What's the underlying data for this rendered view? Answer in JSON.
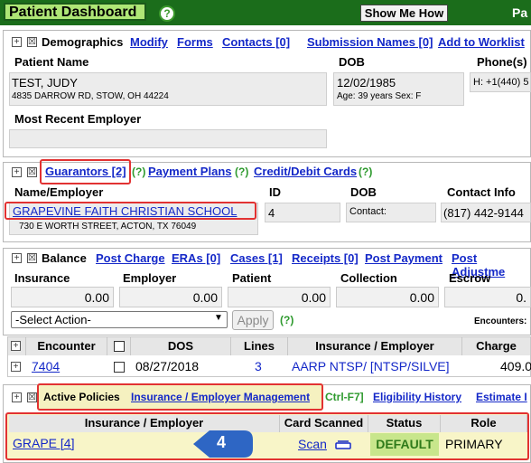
{
  "header": {
    "title": "Patient Dashboard",
    "help": "?",
    "show_me_how": "Show Me How",
    "right_label": "Pa"
  },
  "demographics": {
    "toggle": "+",
    "close": "☒",
    "title": "Demographics",
    "links": [
      "Modify",
      "Forms",
      "Contacts [0]",
      "Submission Names [0]",
      "Add to Worklist"
    ],
    "patient_name_label": "Patient Name",
    "dob_label": "DOB",
    "phone_label": "Phone(s)",
    "patient_name": "TEST, JUDY",
    "address": "4835 DARROW RD, STOW, OH 44224",
    "dob": "12/02/1985",
    "age_sex": "Age: 39 years   Sex: F",
    "phone": "H: +1(440) 5",
    "employer_label": "Most Recent Employer"
  },
  "guarantors": {
    "link": "Guarantors [2]",
    "q": "(?)",
    "payment_plans": "Payment Plans",
    "credit_cards": "Credit/Debit Cards",
    "name_label": "Name/Employer",
    "id_label": "ID",
    "dob_label": "DOB",
    "contact_label": "Contact Info",
    "name": "GRAPEVINE FAITH CHRISTIAN SCHOOL",
    "address": "730 E WORTH STREET, ACTON, TX 76049",
    "id": "4",
    "contact_short": "Contact:",
    "phone": "(817) 442-9144"
  },
  "balance": {
    "title": "Balance",
    "links": [
      "Post Charge",
      "ERAs [0]",
      "Cases [1]",
      "Receipts [0]",
      "Post Payment",
      "Post Adjustme"
    ],
    "columns": [
      "Insurance",
      "Employer",
      "Patient",
      "Collection",
      "Escrow"
    ],
    "values": [
      "0.00",
      "0.00",
      "0.00",
      "0.00",
      "0."
    ],
    "select_action": "-Select Action-",
    "apply": "Apply",
    "q": "(?)",
    "encounters_label": "Encounters:"
  },
  "encounters": {
    "columns": [
      "Encounter",
      "DOS",
      "Lines",
      "Insurance / Employer",
      "Charge"
    ],
    "row": {
      "encounter": "7404",
      "dos": "08/27/2018",
      "lines": "3",
      "insurance": "AARP NTSP/ [NTSP/SILVE]",
      "charge": "409.0"
    }
  },
  "policies": {
    "title": "Active Policies",
    "management_link": "Insurance / Employer Management",
    "shortcut": "Ctrl-F7]",
    "eligibility": "Eligibility History",
    "estimate": "Estimate I",
    "columns": [
      "Insurance / Employer",
      "Card Scanned",
      "Status",
      "Role"
    ],
    "row": {
      "insurance": "GRAPE [4]",
      "scan": "Scan",
      "status": "DEFAULT",
      "role": "PRIMARY"
    },
    "step_badge": "4"
  }
}
